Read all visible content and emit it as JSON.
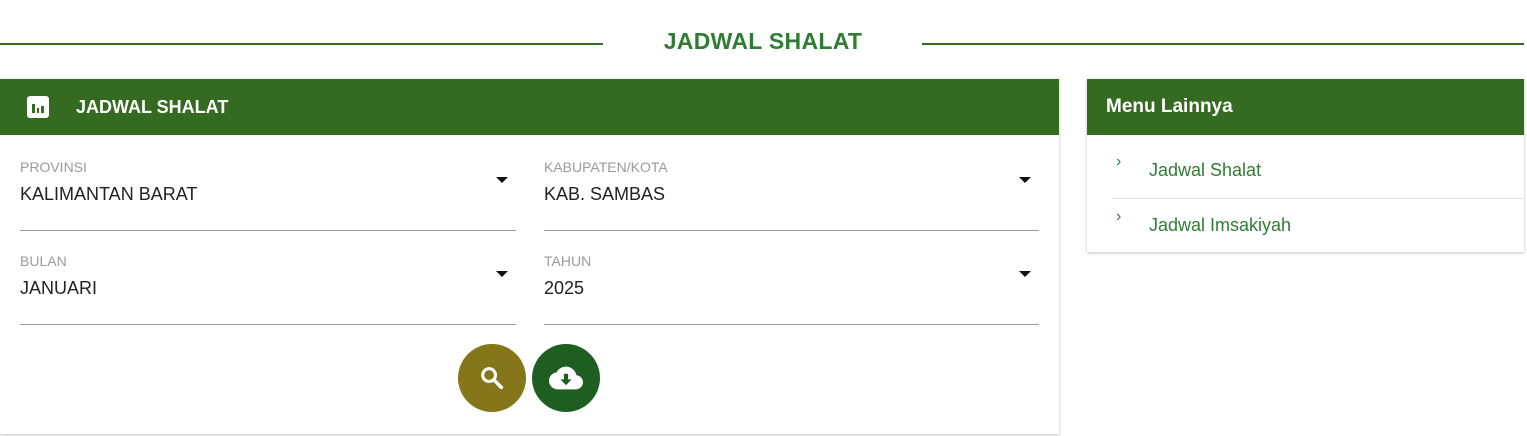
{
  "page": {
    "title": "JADWAL SHALAT"
  },
  "card": {
    "title": "JADWAL SHALAT",
    "fields": {
      "provinsi": {
        "label": "PROVINSI",
        "value": "KALIMANTAN BARAT"
      },
      "kabupaten": {
        "label": "KABUPATEN/KOTA",
        "value": "KAB. SAMBAS"
      },
      "bulan": {
        "label": "BULAN",
        "value": "JANUARI"
      },
      "tahun": {
        "label": "TAHUN",
        "value": "2025"
      }
    },
    "buttons": {
      "search": "search-icon",
      "download": "cloud-download-icon"
    }
  },
  "sidebar": {
    "title": "Menu Lainnya",
    "items": [
      {
        "label": "Jadwal Shalat"
      },
      {
        "label": "Jadwal Imsakiyah"
      }
    ]
  },
  "colors": {
    "primary": "#356b21",
    "search_button": "#85761a",
    "download_button": "#1e5e20"
  }
}
